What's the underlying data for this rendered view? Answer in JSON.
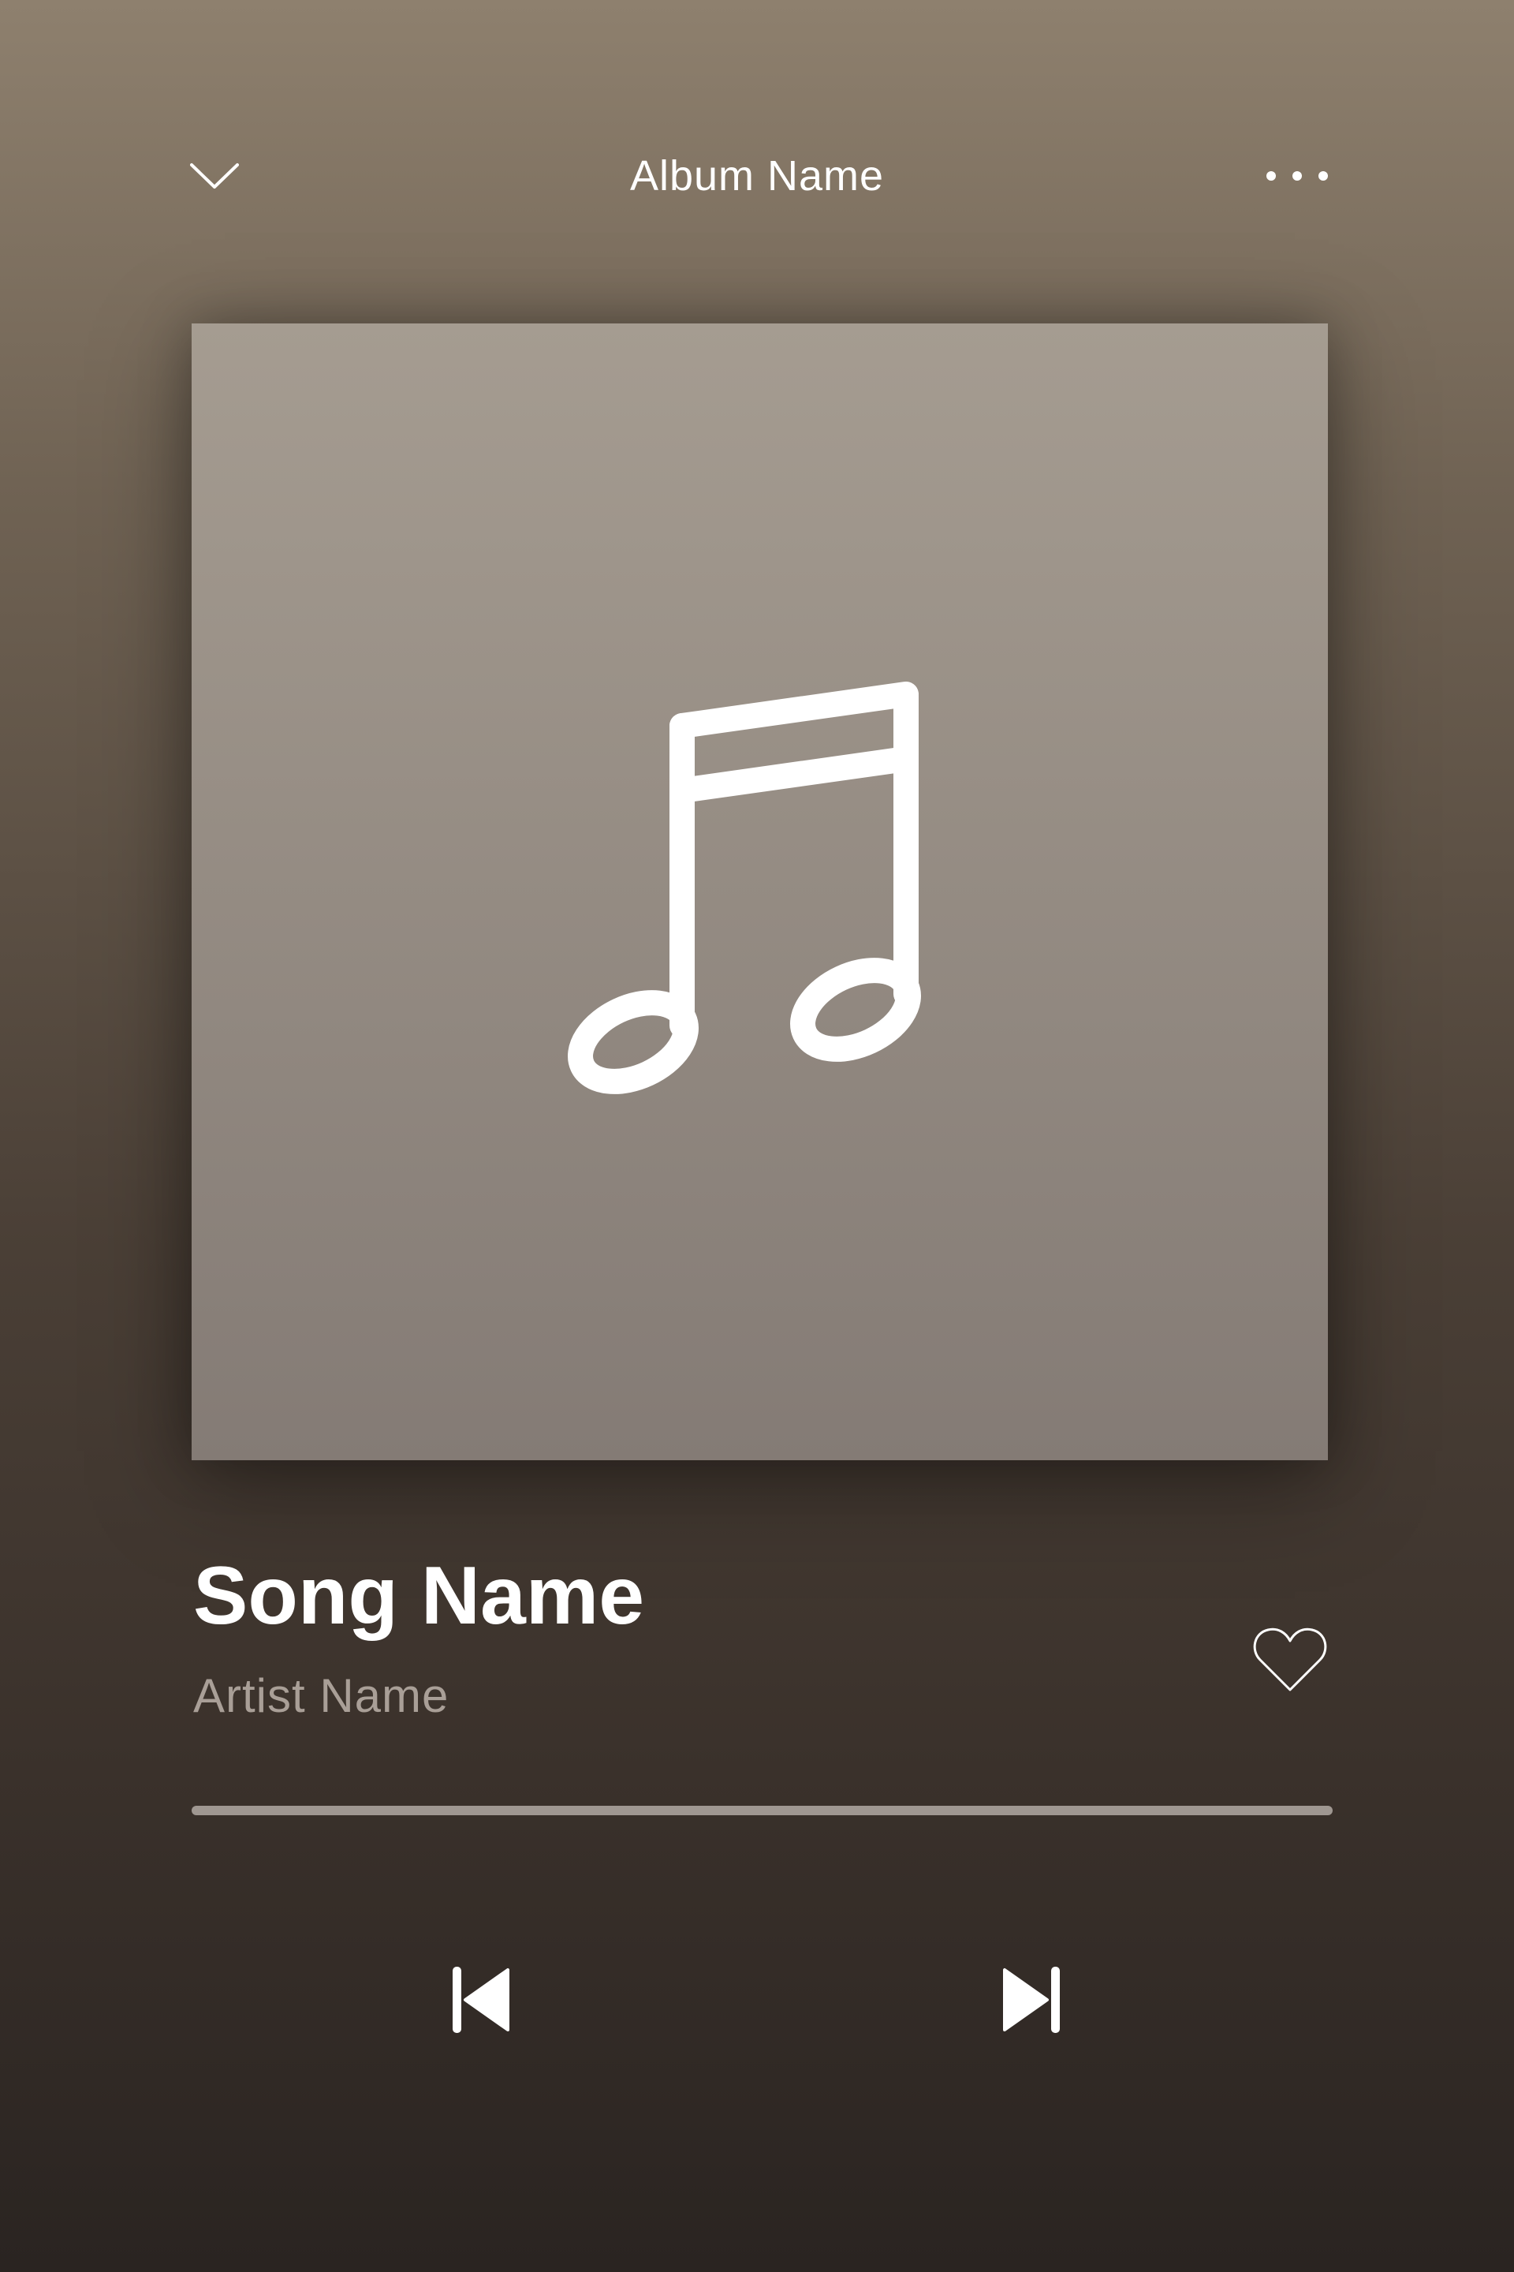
{
  "header": {
    "album_title": "Album Name",
    "collapse_icon": "chevron-down-icon",
    "more_icon": "more-horizontal-icon"
  },
  "cover": {
    "placeholder_icon": "music-note-icon"
  },
  "track": {
    "title": "Song Name",
    "artist": "Artist Name",
    "like_icon": "heart-outline-icon"
  },
  "progress": {
    "fraction": 0
  },
  "controls": {
    "previous_icon": "skip-previous-icon",
    "next_icon": "skip-next-icon"
  },
  "colors": {
    "text_primary": "#ffffff",
    "text_secondary": "#a99f97",
    "progress_track": "#9f9791"
  }
}
